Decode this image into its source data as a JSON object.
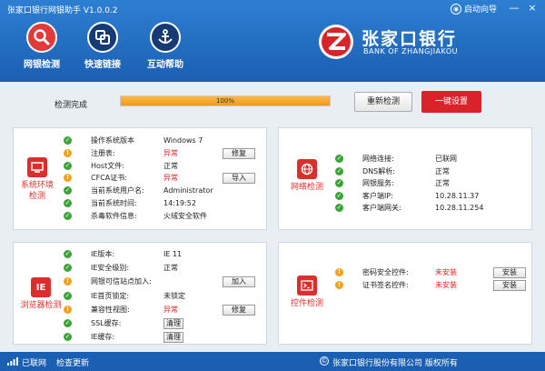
{
  "app": {
    "title": "张家口银行网银助手 V1.0.0.2",
    "startup_guide": "启动向导",
    "minimize": "—",
    "close": "×"
  },
  "toolbar": {
    "check_label": "网银检测",
    "repair_label": "快速链接",
    "help_label": "互动帮助"
  },
  "logo": {
    "name": "张家口银行",
    "en": "BANK OF ZHANGJIAKOU"
  },
  "progress": {
    "label": "检测完成",
    "percent": 100,
    "text": "100%",
    "recheck_label": "重新检测",
    "onekey_label": "一键设置"
  },
  "system": {
    "category": "系统环境检测",
    "rows": [
      {
        "status": "ok",
        "name": "操作系统版本",
        "value": "Windows 7"
      },
      {
        "status": "warn",
        "name": "注册表:",
        "value": "异常",
        "button": "修复"
      },
      {
        "status": "ok",
        "name": "Host文件:",
        "value": "正常"
      },
      {
        "status": "warn",
        "name": "CFCA证书:",
        "value": "异常",
        "button": "导入"
      },
      {
        "status": "ok",
        "name": "当前系统用户名:",
        "value": "Administrator"
      },
      {
        "status": "ok",
        "name": "当前系统时间:",
        "value": "14:19:52"
      },
      {
        "status": "ok",
        "name": "杀毒软件信息:",
        "value": "火绒安全软件"
      }
    ]
  },
  "network": {
    "category": "网络检测",
    "rows": [
      {
        "status": "ok",
        "name": "网络连接:",
        "value": "已联网"
      },
      {
        "status": "ok",
        "name": "DNS解析:",
        "value": "正常"
      },
      {
        "status": "ok",
        "name": "网银服务:",
        "value": "正常"
      },
      {
        "status": "ok",
        "name": "客户端IP:",
        "value": "10.28.11.37"
      },
      {
        "status": "ok",
        "name": "客户端网关:",
        "value": "10.28.11.254"
      }
    ]
  },
  "browser": {
    "category": "浏览器检测",
    "rows": [
      {
        "status": "ok",
        "name": "IE版本:",
        "value": "IE 11"
      },
      {
        "status": "ok",
        "name": "IE安全级别:",
        "value": "正常"
      },
      {
        "status": "warn",
        "name": "网银可信站点加入:",
        "value": "",
        "button": "加入"
      },
      {
        "status": "ok",
        "name": "IE首页锁定:",
        "value": "未锁定"
      },
      {
        "status": "warn",
        "name": "兼容性视图:",
        "value": "异常",
        "button": "修复"
      },
      {
        "status": "ok",
        "name": "SSL缓存:",
        "value": "",
        "button": "清理"
      },
      {
        "status": "ok",
        "name": "IE缓存:",
        "value": "",
        "button": "清理"
      }
    ]
  },
  "controls": {
    "category": "控件检测",
    "rows": [
      {
        "status": "warn",
        "name": "密码安全控件:",
        "value": "未安装",
        "button": "安装"
      },
      {
        "status": "warn",
        "name": "证书签名控件:",
        "value": "未安装",
        "button": "安装"
      }
    ]
  },
  "footer": {
    "net_status": "已联网",
    "update": "检查更新",
    "copyright_symbol": "©",
    "copyright": "张家口银行股份有限公司  版权所有"
  },
  "colors": {
    "header": "#1b5fb3",
    "accent_red": "#d9232a",
    "ok_green": "#3aa437",
    "warn_orange": "#f2a11c"
  }
}
